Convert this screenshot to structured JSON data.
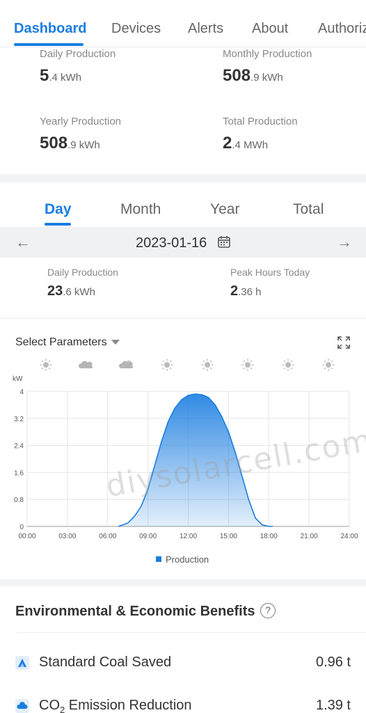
{
  "nav": {
    "tabs": [
      "Dashboard",
      "Devices",
      "Alerts",
      "About",
      "Authoriz"
    ],
    "active": "Dashboard"
  },
  "summary": {
    "daily": {
      "label": "Daily Production",
      "big": "5",
      "small": ".4 kWh"
    },
    "monthly": {
      "label": "Monthly Production",
      "big": "508",
      "small": ".9 kWh"
    },
    "yearly": {
      "label": "Yearly Production",
      "big": "508",
      "small": ".9 kWh"
    },
    "total": {
      "label": "Total Production",
      "big": "2",
      "small": ".4 MWh"
    }
  },
  "period": {
    "tabs": [
      "Day",
      "Month",
      "Year",
      "Total"
    ],
    "active": "Day",
    "date": "2023-01-16",
    "daily": {
      "label": "Daily Production",
      "big": "23",
      "small": ".6 kWh"
    },
    "peak": {
      "label": "Peak Hours Today",
      "big": "2",
      "small": ".36 h"
    }
  },
  "chart_section": {
    "select_label": "Select Parameters",
    "watermark": "diysolarcell.com",
    "weather_icons": [
      "sun-icon",
      "cloud-icon",
      "partly-cloudy-icon",
      "sun-icon",
      "sun-icon",
      "sun-icon",
      "sun-icon",
      "sun-icon"
    ]
  },
  "chart_data": {
    "type": "area",
    "ylabel": "kW",
    "ylim": [
      0,
      4
    ],
    "yticks": [
      "0",
      "0.8",
      "1.6",
      "2.4",
      "3.2",
      "4"
    ],
    "xticks": [
      "00:00",
      "03:00",
      "06:00",
      "09:00",
      "12:00",
      "15:00",
      "18:00",
      "21:00",
      "24:00"
    ],
    "xlim": [
      0,
      24
    ],
    "grid": true,
    "legend": "bottom-center",
    "color": "#1a7de0",
    "series": [
      {
        "name": "Production",
        "x": [
          6.8,
          7.5,
          8.0,
          8.5,
          9.0,
          9.5,
          10.0,
          10.5,
          11.0,
          11.5,
          12.0,
          12.5,
          13.0,
          13.5,
          14.0,
          14.5,
          15.0,
          15.5,
          16.0,
          16.5,
          17.0,
          17.5,
          18.0,
          18.3
        ],
        "values": [
          0,
          0.1,
          0.3,
          0.6,
          1.1,
          1.8,
          2.5,
          3.1,
          3.5,
          3.75,
          3.88,
          3.92,
          3.9,
          3.82,
          3.6,
          3.25,
          2.8,
          2.2,
          1.5,
          0.8,
          0.25,
          0.05,
          0,
          0
        ]
      }
    ]
  },
  "benefits": {
    "title": "Environmental & Economic Benefits",
    "help": "?",
    "items": [
      {
        "label": "Standard Coal Saved",
        "value": "0.96 t"
      },
      {
        "label": "CO",
        "sub": "2",
        "suffix": " Emission Reduction",
        "value": "1.39 t"
      }
    ]
  }
}
